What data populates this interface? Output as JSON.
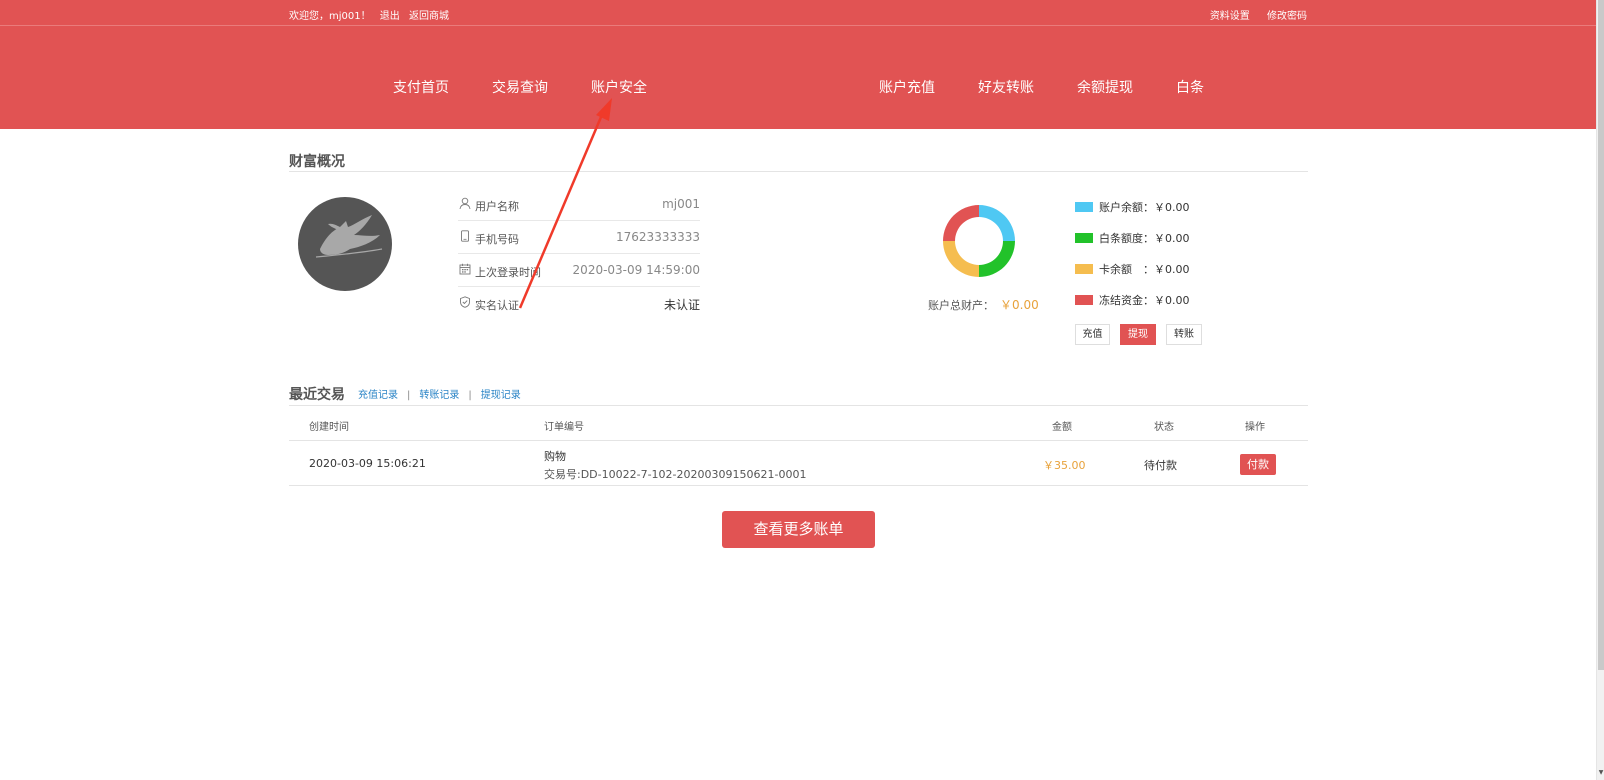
{
  "topbar": {
    "welcome": "欢迎您，mj001！",
    "logout": "退出",
    "back_to_mall": "返回商城",
    "profile_settings": "资料设置",
    "change_password": "修改密码"
  },
  "nav": {
    "left": [
      "支付首页",
      "交易查询",
      "账户安全"
    ],
    "right": [
      "账户充值",
      "好友转账",
      "余额提现",
      "白条"
    ]
  },
  "wealth": {
    "title": "财富概况",
    "username_label": "用户名称",
    "username": "mj001",
    "phone_label": "手机号码",
    "phone": "17623333333",
    "last_login_label": "上次登录时间",
    "last_login": "2020-03-09 14:59:00",
    "realname_label": "实名认证",
    "realname_status": "未认证",
    "total_label": "账户总财产：",
    "total_value": "￥0.00",
    "legend": [
      {
        "label": "账户余额：",
        "value": "￥0.00",
        "color": "#4fc8f3"
      },
      {
        "label": "白条额度：",
        "value": "￥0.00",
        "color": "#22c22a"
      },
      {
        "label": "卡余额　：",
        "value": "￥0.00",
        "color": "#f5bd4f"
      },
      {
        "label": "冻结资金：",
        "value": "￥0.00",
        "color": "#e15353"
      }
    ],
    "buttons": {
      "recharge": "充值",
      "withdraw": "提现",
      "transfer": "转账"
    }
  },
  "recent": {
    "title": "最近交易",
    "tabs": [
      "充值记录",
      "转账记录",
      "提现记录"
    ],
    "columns": [
      "创建时间",
      "订单编号",
      "金额",
      "状态",
      "操作"
    ],
    "rows": [
      {
        "created": "2020-03-09 15:06:21",
        "order_name": "购物",
        "order_no": "交易号:DD-10022-7-102-20200309150621-0001",
        "amount": "￥35.00",
        "status": "待付款",
        "action": "付款"
      }
    ],
    "more_button": "查看更多账单"
  },
  "colors": {
    "brand_red": "#e15353",
    "amount_orange": "#e8a23b",
    "link_blue": "#2a84c6"
  }
}
